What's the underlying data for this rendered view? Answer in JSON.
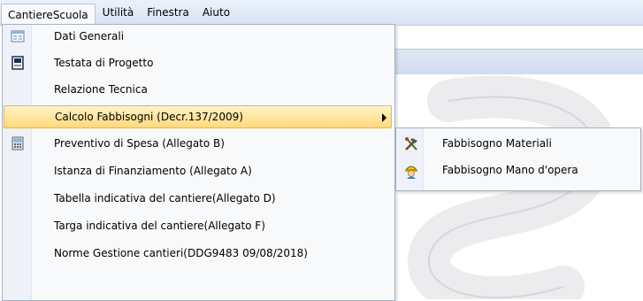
{
  "menubar": {
    "items": [
      {
        "label": "CantiereScuola",
        "active": true
      },
      {
        "label": "Utilità",
        "active": false
      },
      {
        "label": "Finestra",
        "active": false
      },
      {
        "label": "Aiuto",
        "active": false
      }
    ]
  },
  "menu": {
    "items": [
      {
        "label": "Dati Generali",
        "icon": "form-window-icon"
      },
      {
        "label": "Testata di Progetto",
        "icon": "document-frame-icon"
      },
      {
        "label": "Relazione Tecnica",
        "icon": ""
      },
      {
        "label": "Calcolo Fabbisogni (Decr.137/2009)",
        "icon": "",
        "highlighted": true,
        "submenu": true
      },
      {
        "label": "Preventivo di Spesa (Allegato B)",
        "icon": "calculator-icon"
      },
      {
        "label": "Istanza di Finanziamento (Allegato A)",
        "icon": ""
      },
      {
        "label": "Tabella indicativa del cantiere(Allegato D)",
        "icon": ""
      },
      {
        "label": "Targa indicativa del cantiere(Allegato F)",
        "icon": ""
      },
      {
        "label": "Norme Gestione cantieri(DDG9483 09/08/2018)",
        "icon": ""
      }
    ]
  },
  "submenu": {
    "items": [
      {
        "label": "Fabbisogno Materiali",
        "icon": "tools-icon"
      },
      {
        "label": "Fabbisogno Mano d'opera",
        "icon": "worker-helmet-icon"
      }
    ]
  },
  "colors": {
    "highlight_top": "#fff3c8",
    "highlight_bottom": "#ffd97a",
    "menubar": "#dfe8f6",
    "gutter": "#eef2f8"
  }
}
